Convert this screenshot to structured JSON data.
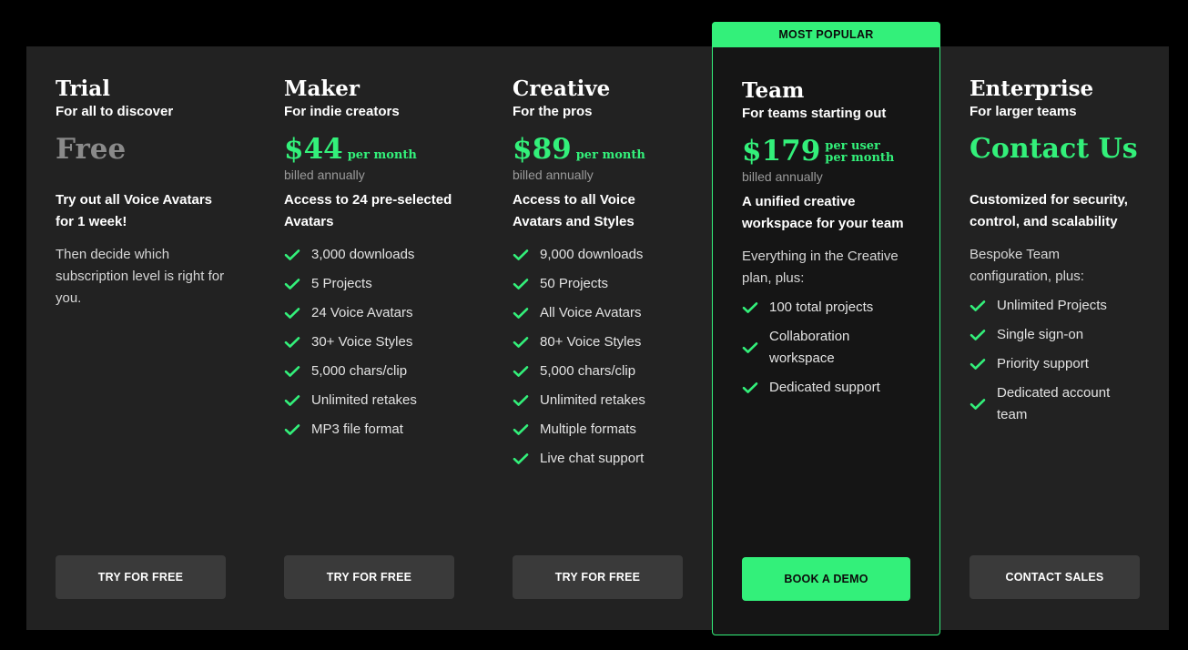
{
  "colors": {
    "accent": "#33f07a",
    "panel": "#222222",
    "featured_bg": "#151515",
    "button": "#3a3a3a"
  },
  "badge": "MOST POPULAR",
  "plans": [
    {
      "name": "Trial",
      "tagline": "For all to discover",
      "price": "Free",
      "per": "",
      "billed": "",
      "headline": "Try out all Voice Avatars for 1 week!",
      "description": "Then decide which subscription level is right for you.",
      "features": [],
      "cta": "TRY FOR FREE"
    },
    {
      "name": "Maker",
      "tagline": "For indie creators",
      "price": "$44",
      "per": "per month",
      "billed": "billed annually",
      "headline": "Access to 24 pre-selected Avatars",
      "description": "",
      "features": [
        "3,000 downloads",
        "5 Projects",
        "24 Voice Avatars",
        "30+ Voice Styles",
        "5,000 chars/clip",
        "Unlimited retakes",
        "MP3 file format"
      ],
      "cta": "TRY FOR FREE"
    },
    {
      "name": "Creative",
      "tagline": "For the pros",
      "price": "$89",
      "per": "per month",
      "billed": "billed annually",
      "headline": "Access to all Voice Avatars and Styles",
      "description": "",
      "features": [
        "9,000 downloads",
        "50 Projects",
        "All Voice Avatars",
        "80+ Voice Styles",
        "5,000 chars/clip",
        "Unlimited retakes",
        "Multiple formats",
        "Live chat support"
      ],
      "cta": "TRY FOR FREE"
    },
    {
      "name": "Team",
      "tagline": "For teams starting out",
      "price": "$179",
      "per_line1": "per user",
      "per_line2": "per month",
      "billed": "billed annually",
      "headline": "A unified creative workspace for your team",
      "description": "Everything in the Creative plan, plus:",
      "features": [
        "100 total projects",
        "Collaboration workspace",
        "Dedicated support"
      ],
      "cta": "BOOK A DEMO"
    },
    {
      "name": "Enterprise",
      "tagline": "For larger teams",
      "price": "Contact Us",
      "per": "",
      "billed": "",
      "headline": "Customized for security, control, and scalability",
      "description": "Bespoke Team configuration, plus:",
      "features": [
        "Unlimited Projects",
        "Single sign-on",
        "Priority support",
        "Dedicated account team"
      ],
      "cta": "CONTACT SALES"
    }
  ]
}
